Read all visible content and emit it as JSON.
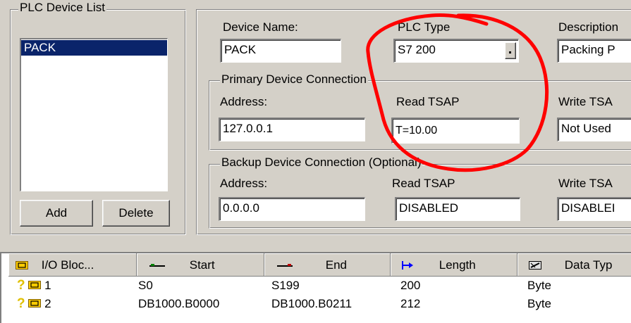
{
  "device_list": {
    "title": "PLC Device List",
    "items": [
      "PACK"
    ],
    "add_label": "Add",
    "delete_label": "Delete"
  },
  "device": {
    "name_label": "Device Name:",
    "name_value": "PACK",
    "type_label": "PLC Type",
    "type_value": "S7 200",
    "description_label": "Description",
    "description_value": "Packing P"
  },
  "primary": {
    "title": "Primary Device Connection",
    "address_label": "Address:",
    "address_value": "127.0.0.1",
    "read_tsap_label": "Read TSAP",
    "read_tsap_value": "T=10.00",
    "write_tsap_label": "Write TSA",
    "write_tsap_value": "Not Used"
  },
  "backup": {
    "title": "Backup Device Connection (Optional)",
    "address_label": "Address:",
    "address_value": "0.0.0.0",
    "read_tsap_label": "Read TSAP",
    "read_tsap_value": "DISABLED",
    "write_tsap_label": "Write TSA",
    "write_tsap_value": "DISABLEI"
  },
  "grid": {
    "headers": [
      "I/O Bloc...",
      "Start",
      "End",
      "Length",
      "Data Typ"
    ],
    "rows": [
      {
        "block": "1",
        "start": "S0",
        "end": "S199",
        "length": "200",
        "type": "Byte"
      },
      {
        "block": "2",
        "start": "DB1000.B0000",
        "end": "DB1000.B0211",
        "length": "212",
        "type": "Byte"
      }
    ]
  },
  "colors": {
    "annotation": "#ff0000",
    "selection": "#0a246a"
  },
  "icons": [
    "block-icon",
    "start-icon",
    "end-icon",
    "length-icon",
    "datatype-icon",
    "warning-icon"
  ]
}
